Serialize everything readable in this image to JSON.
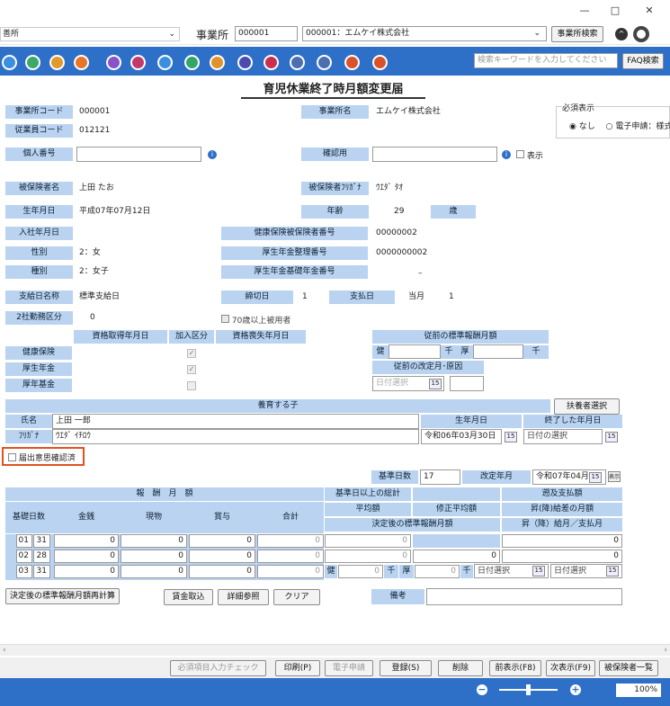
{
  "titlebar": {
    "minimize": "—",
    "maximize": "□",
    "close": "✕"
  },
  "topbar": {
    "left_select": "善所",
    "office_label": "事業所",
    "office_code": "000001",
    "office_select": "000001：エムケイ株式会社",
    "office_search_btn": "事業所検索"
  },
  "iconbar": {
    "search_placeholder": "検索キーワードを入力してください",
    "faq_btn": "FAQ検索"
  },
  "colors": {
    "accent": "#2e6fc7",
    "label_bg": "#b9d3f0",
    "highlight": "#e0521f"
  },
  "page_title": "育児休業終了時月額変更届",
  "required_display": {
    "title": "必須表示",
    "opt_none": "なし",
    "opt_e": "電子申請：様式"
  },
  "form": {
    "office_code_lbl": "事業所コード",
    "office_code": "000001",
    "office_name_lbl": "事業所名",
    "office_name": "エムケイ株式会社",
    "emp_code_lbl": "従業員コード",
    "emp_code": "012121",
    "mynumber_lbl": "個人番号",
    "confirm_lbl": "確認用",
    "show_lbl": "表示",
    "insured_name_lbl": "被保険者名",
    "insured_name": "上田 たお",
    "insured_kana_lbl": "被保険者ﾌﾘｶﾞﾅ",
    "insured_kana": "ｳｴﾀﾞ ﾀｵ",
    "birth_lbl": "生年月日",
    "birth": "平成07年07月12日",
    "age_lbl": "年齢",
    "age": "29",
    "age_unit": "歳",
    "join_lbl": "入社年月日",
    "health_no_lbl": "健康保険被保険者番号",
    "health_no": "00000002",
    "gender_lbl": "性別",
    "gender": "2：女",
    "pension_no_lbl": "厚生年金整理番号",
    "pension_no": "0000000002",
    "type_lbl": "種別",
    "type": "2：女子",
    "basic_pension_lbl": "厚生年金基礎年金番号",
    "basic_pension": "–",
    "pay_name_lbl": "支給日名称",
    "pay_name": "標準支給日",
    "close_lbl": "締切日",
    "close": "1",
    "pay_day_lbl": "支払日",
    "pay_month": "当月",
    "pay_day": "1",
    "work_lbl": "2社勤務区分",
    "work": "0",
    "over70_lbl": "70歳以上被用者"
  },
  "qual": {
    "acquire_hdr": "資格取得年月日",
    "join_hdr": "加入区分",
    "loss_hdr": "資格喪失年月日",
    "rows": [
      "健康保険",
      "厚生年金",
      "厚年基金"
    ],
    "prev_std_hdr": "従前の標準報酬月額",
    "ken": "健",
    "sen": "千",
    "kou": "厚",
    "prev_rev_hdr": "従前の改定月･原因",
    "date_sel": "日付選択"
  },
  "child": {
    "hdr": "養育する子",
    "dependent_btn": "扶養者選択",
    "name_lbl": "氏名",
    "name": "上田 一郎",
    "kana_lbl": "ﾌﾘｶﾞﾅ",
    "kana": "ｳｴﾀﾞ ｲﾁﾛｳ",
    "birth_hdr": "生年月日",
    "birth": "令和06年03月30日",
    "end_hdr": "終了した年月日",
    "end": "日付の選択"
  },
  "notice_lbl": "届出意思確認済",
  "basis": {
    "days_lbl": "基準日数",
    "days": "17",
    "rev_month_lbl": "改定年月",
    "rev_month": "令和07年04月",
    "cal_icon": "表示"
  },
  "pay": {
    "hdr": "報　酬　月　額",
    "cols": [
      "基礎日数",
      "金銭",
      "現物",
      "賞与",
      "合計"
    ],
    "rows": [
      {
        "m": "01",
        "d": "31",
        "v1": "0",
        "v2": "0",
        "v3": "0",
        "v4": "0"
      },
      {
        "m": "02",
        "d": "28",
        "v1": "0",
        "v2": "0",
        "v3": "0",
        "v4": "0"
      },
      {
        "m": "03",
        "d": "31",
        "v1": "0",
        "v2": "0",
        "v3": "0",
        "v4": "0"
      }
    ],
    "over_hdr": "基準日以上の総計",
    "avg_hdr": "平均額",
    "adj_avg_hdr": "修正平均額",
    "retro_hdr": "遡及支払額",
    "diff_hdr": "昇(降)給差の月額",
    "after_hdr": "決定後の標準報酬月額",
    "raise_hdr": "昇（降）給月／支払月",
    "sum1": "0",
    "sum2": "0",
    "adj": "0",
    "retro": "0",
    "diff": "0",
    "ken": "健",
    "ken_v": "0",
    "sen": "千",
    "kou": "厚",
    "kou_v": "0",
    "sen2": "千",
    "date_sel1": "日付選択",
    "date_sel2": "日付選択"
  },
  "actions": {
    "recalc": "決定後の標準報酬月額再計算",
    "wage": "賃金取込",
    "detail": "詳細参照",
    "clear": "クリア",
    "remark_lbl": "備考"
  },
  "bottom": {
    "check": "必須項目入力チェック",
    "print": "印刷(P)",
    "e_apply": "電子申請",
    "register": "登録(S)",
    "delete": "削除",
    "prev": "前表示(F8)",
    "next": "次表示(F9)",
    "list": "被保険者一覧"
  },
  "status": {
    "zoom": "100%",
    "minus": "−",
    "plus": "+"
  }
}
